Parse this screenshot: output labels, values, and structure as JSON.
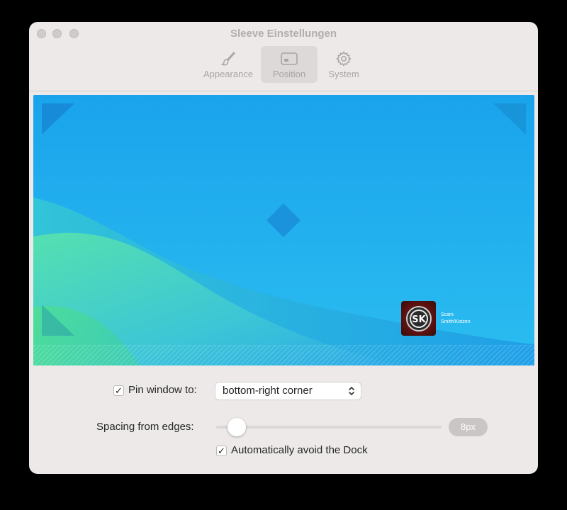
{
  "window": {
    "title": "Sleeve Einstellungen"
  },
  "toolbar": {
    "tabs": [
      {
        "label": "Appearance",
        "icon": "paintbrush-icon",
        "active": false
      },
      {
        "label": "Position",
        "icon": "window-position-icon",
        "active": true
      },
      {
        "label": "System",
        "icon": "gear-icon",
        "active": false
      }
    ]
  },
  "preview": {
    "now_playing": {
      "track": "Scars",
      "artist": "Smith/Kotzen"
    }
  },
  "settings": {
    "pin_window": {
      "label": "Pin window to:",
      "checked": true,
      "selected_option": "bottom-right corner"
    },
    "spacing": {
      "label": "Spacing from edges:",
      "value_text": "8px",
      "level": 0.05
    },
    "avoid_dock": {
      "label": "Automatically avoid the Dock",
      "checked": true
    }
  }
}
